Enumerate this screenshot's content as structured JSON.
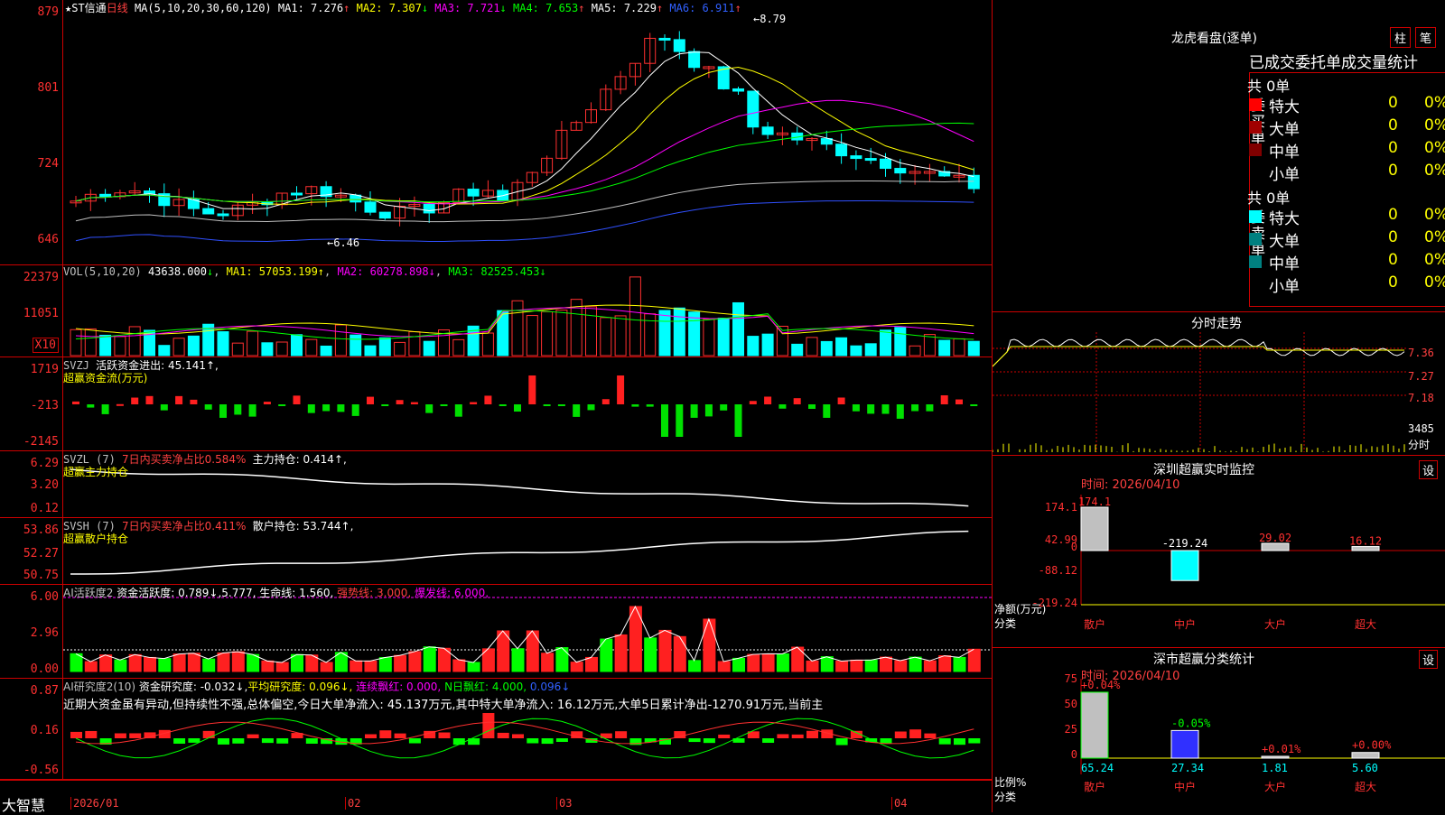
{
  "app": "大智慧",
  "main": {
    "stock": "★ST信通",
    "period": "日线",
    "ma_head": "MA(5,10,20,30,60,120)",
    "ma": [
      [
        "MA1: 7.276",
        "↑"
      ],
      [
        "MA2: 7.307",
        "↓"
      ],
      [
        "MA3: 7.721",
        "↓"
      ],
      [
        "MA4: 7.653",
        "↑"
      ],
      [
        "MA5: 7.229",
        "↑"
      ],
      [
        "MA6: 6.911",
        "↑"
      ]
    ],
    "hi": "8.79",
    "lo": "6.46",
    "y": [
      "879",
      "801",
      "724",
      "646"
    ]
  },
  "vol": {
    "h": "VOL(5,10,20)",
    "v": "43638.000",
    "a": [
      "MA1: 57053.199↑",
      "MA2: 60278.898↓",
      "MA3: 82525.453↓"
    ],
    "y": [
      "22379",
      "11051"
    ],
    "unit": "X10"
  },
  "svzj": {
    "h": "SVZJ",
    "d": "活跃资金进出: 45.141↑,",
    "s": "超赢资金流(万元)",
    "y": [
      "1719",
      "-213",
      "-2145"
    ]
  },
  "svzl": {
    "h": "SVZL (7)",
    "a": "7日内买卖净占比0.584%",
    "b": "主力持仓: 0.414↑,",
    "s": "超赢主力持仓",
    "y": [
      "6.29",
      "3.20",
      "0.12"
    ]
  },
  "svsh": {
    "h": "SVSH (7)",
    "a": "7日内买卖净占比0.411%",
    "b": "散户持仓: 53.744↑,",
    "s": "超赢散户持仓",
    "y": [
      "53.86",
      "52.27",
      "50.75"
    ]
  },
  "ai1": {
    "h": "AI活跃度2",
    "a": "资金活跃度: 0.789↓,5.777,",
    "b": "生命线: 1.560,",
    "c": "强势线: 3.000,",
    "d": "爆发线: 6.000,",
    "y": [
      "6.00",
      "2.96",
      "0.00"
    ]
  },
  "ai2": {
    "h": "AI研究度2(10)",
    "a": "资金研究度: -0.032↓,",
    "b": "平均研究度: 0.096↓,",
    "c": "连续飘红: 0.000,",
    "d": "N日飘红: 4.000,",
    "e": "0.096↓",
    "txt": "近期大资金虽有异动,但持续性不强,总体偏空,今日大单净流入: 45.137万元,其中特大单净流入: 16.12万元,大单5日累计净出-1270.91万元,当前主",
    "y": [
      "0.87",
      "0.16",
      "-0.56"
    ]
  },
  "xaxis": [
    "2026/01",
    "02",
    "03",
    "04"
  ],
  "lhb": {
    "title": "龙虎看盘(逐单)",
    "tabs": [
      "柱",
      "笔"
    ],
    "head": "已成交委托单成交量统计",
    "buy": "委买单",
    "sell": "委卖单",
    "total": "共 0单",
    "rows": [
      "特大",
      "大单",
      "中单",
      "小单"
    ],
    "zero": "0",
    "pct": "0%",
    "bc": [
      "#ff0000",
      "#a00000",
      "#800000",
      ""
    ],
    "sc": [
      "#00ffff",
      "#008080",
      "#008080",
      ""
    ]
  },
  "fs": {
    "title": "分时走势",
    "y": [
      "7.36",
      "7.27",
      "7.18"
    ],
    "vol": "3485",
    "unit": "分时"
  },
  "szm": {
    "title": "深圳超赢实时监控",
    "time": "时间: 2026/04/10",
    "set": "设",
    "y": [
      "174.1",
      "42.99",
      "0",
      "-88.12",
      "-219.24"
    ],
    "ylab": [
      "净额(万元)",
      "分类"
    ],
    "bars": [
      {
        "n": "散户",
        "v": 174.1,
        "l": "174.1"
      },
      {
        "n": "中户",
        "v": -219.24,
        "l": "-219.24"
      },
      {
        "n": "大户",
        "v": 29.02,
        "l": "29.02"
      },
      {
        "n": "超大",
        "v": 16.12,
        "l": "16.12"
      }
    ]
  },
  "szc": {
    "title": "深市超赢分类统计",
    "time": "时间: 2026/04/10",
    "set": "设",
    "y": [
      "75",
      "50",
      "25",
      "0"
    ],
    "ylab": [
      "比例%",
      "分类"
    ],
    "bars": [
      {
        "n": "散户",
        "v": 65.24,
        "t": "+0.04%"
      },
      {
        "n": "中户",
        "v": 27.34,
        "t": "-0.05%"
      },
      {
        "n": "大户",
        "v": 1.81,
        "t": "+0.01%"
      },
      {
        "n": "超大",
        "v": 5.6,
        "t": "+0.00%"
      }
    ],
    "vals": [
      "65.24",
      "27.34",
      "1.81",
      "5.60"
    ]
  }
}
